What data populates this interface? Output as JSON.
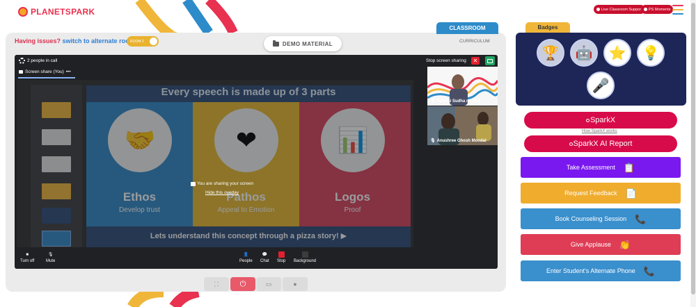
{
  "app": {
    "logo_text": "PLANETSPARK",
    "support_pill": "Live Classroom Support",
    "moments_pill": "PS Moments"
  },
  "left_panel": {
    "issues_text": "Having issues?",
    "alternate_room_link": "switch to alternate room",
    "room_toggle_label": "ROOM 2",
    "demo_material_label": "DEMO MATERIAL",
    "classroom_tab": "CLASSROOM",
    "curriculum_tab": "CURRICULUM"
  },
  "meeting": {
    "people_count": "2 people in call",
    "stop_sharing_label": "Stop screen sharing",
    "screen_tab_label": "Screen share (You)",
    "screen_tab_more": "•••",
    "sharing_message": "You are sharing your screen",
    "hide_overlay": "Hide this overlay",
    "participants": [
      {
        "name": "Keerthi Sudha n (You)"
      },
      {
        "name": "Anushree Ghosh Mondal"
      }
    ],
    "controls_left": [
      {
        "label": "Turn off",
        "icon": "camera-icon"
      },
      {
        "label": "Mute",
        "icon": "microphone-icon"
      }
    ],
    "controls_center": [
      {
        "label": "People",
        "icon": "people-icon"
      },
      {
        "label": "Chat",
        "icon": "chat-icon"
      },
      {
        "label": "Stop",
        "icon": "stop-share-icon"
      },
      {
        "label": "Background",
        "icon": "background-icon"
      }
    ]
  },
  "slide": {
    "heading": "Every speech is made up of 3 parts",
    "columns": [
      {
        "title": "Ethos",
        "subtitle": "Develop trust",
        "color": "#2e88c8",
        "icon": "handshake-icon"
      },
      {
        "title": "Pathos",
        "subtitle": "Appeal to Emotion",
        "color": "#e8b92c",
        "icon": "heart-hands-icon"
      },
      {
        "title": "Logos",
        "subtitle": "Proof",
        "color": "#d9405b",
        "icon": "bar-chart-icon"
      }
    ],
    "footer": "Lets understand this concept through a pizza story!"
  },
  "right_panel": {
    "badges_tab": "Badges",
    "sparkx_label": "SparkX",
    "how_sparkx": "How SparkX works",
    "sparkx_ai_label": "SparkX AI Report",
    "actions": [
      {
        "label": "Take Assessment",
        "color": "#7a18f0",
        "icon": "clipboard-icon"
      },
      {
        "label": "Request Feedback",
        "color": "#f0ac2c",
        "icon": "document-icon"
      },
      {
        "label": "Book Counseling Session",
        "color": "#3a8fcd",
        "icon": "phone-icon"
      },
      {
        "label": "Give Applause",
        "color": "#de3d55",
        "icon": "clapping-hands-icon"
      },
      {
        "label": "Enter Student's Alternate Phone",
        "color": "#3a8fcd",
        "icon": "phone-icon"
      }
    ]
  },
  "colors": {
    "brand_red": "#d80b4a",
    "meet_bg": "#202124",
    "badges_bg": "#1e2557",
    "classroom_blue": "#2e8bc9"
  }
}
